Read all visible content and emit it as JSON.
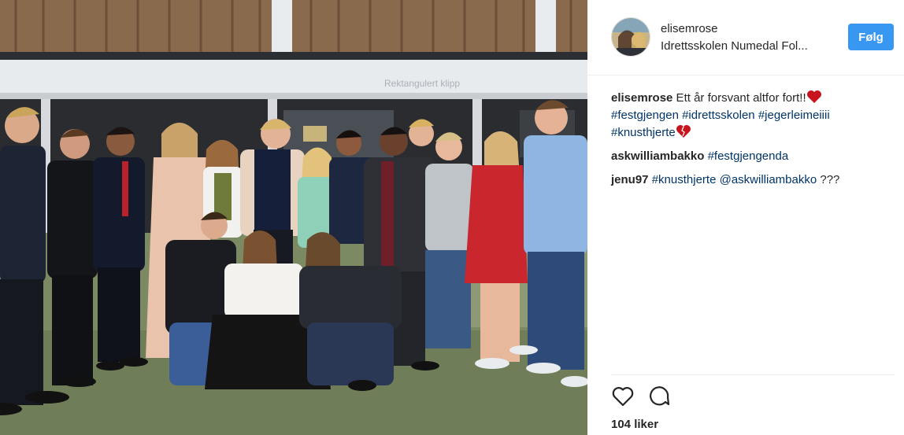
{
  "post": {
    "username": "elisemrose",
    "location": "Idrettsskolen Numedal Fol...",
    "follow_label": "Følg",
    "photo_watermark": "Rektangulert klipp"
  },
  "comments": [
    {
      "user": "elisemrose",
      "text": " Ett år forsvant altfor fort!!",
      "emoji": "heart",
      "hashtags": [
        "#festgjengen",
        "#idrettsskolen",
        "#jegerleimeiiii",
        "#knusthjerte"
      ],
      "trailing_emoji": "broken-heart"
    },
    {
      "user": "askwilliambakko",
      "hashtags": [
        "#festgjengenda"
      ]
    },
    {
      "user": "jenu97",
      "hashtags": [
        "#knusthjerte"
      ],
      "mention": "@askwilliambakko",
      "suffix": " ???"
    }
  ],
  "actions": {
    "like_icon": "heart-outline-icon",
    "comment_icon": "speech-bubble-icon"
  },
  "likes_text": "104 liker",
  "colors": {
    "follow_button": "#3897f0",
    "hashtag": "#003569",
    "text": "#262626",
    "divider": "#efefef"
  }
}
